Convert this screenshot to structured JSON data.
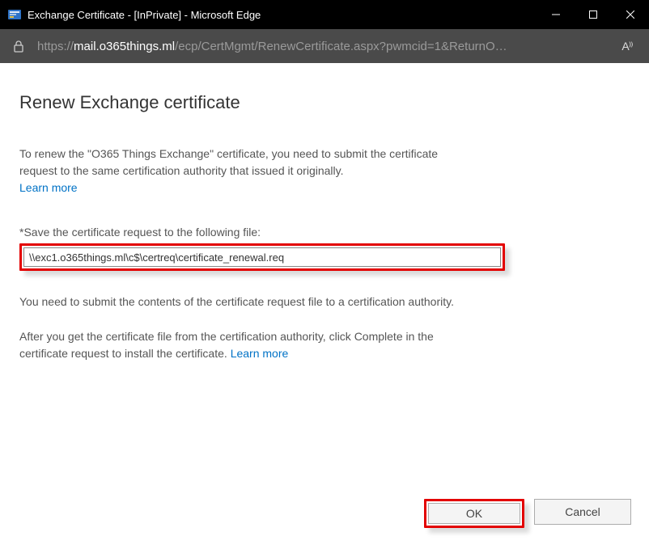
{
  "window": {
    "title": "Exchange Certificate - [InPrivate] - Microsoft Edge"
  },
  "address": {
    "protocol": "https://",
    "host": "mail.o365things.ml",
    "path": "/ecp/CertMgmt/RenewCertificate.aspx?pwmcid=1&ReturnO…",
    "read_aloud_label": "A⁾⁾"
  },
  "page": {
    "heading": "Renew Exchange certificate",
    "intro": "To renew the \"O365 Things Exchange\" certificate, you need to submit the certificate request to the same certification authority that issued it originally.",
    "learn_more": "Learn more",
    "field_label": "*Save the certificate request to the following file:",
    "field_value": "\\\\exc1.o365things.ml\\c$\\certreq\\certificate_renewal.req",
    "submit_text": "You need to submit the contents of the certificate request file to a certification authority.",
    "complete_text_a": "After you get the certificate file from the certification authority, click Complete in the certificate request to install the certificate. ",
    "learn_more_2": "Learn more"
  },
  "buttons": {
    "ok": "OK",
    "cancel": "Cancel"
  }
}
